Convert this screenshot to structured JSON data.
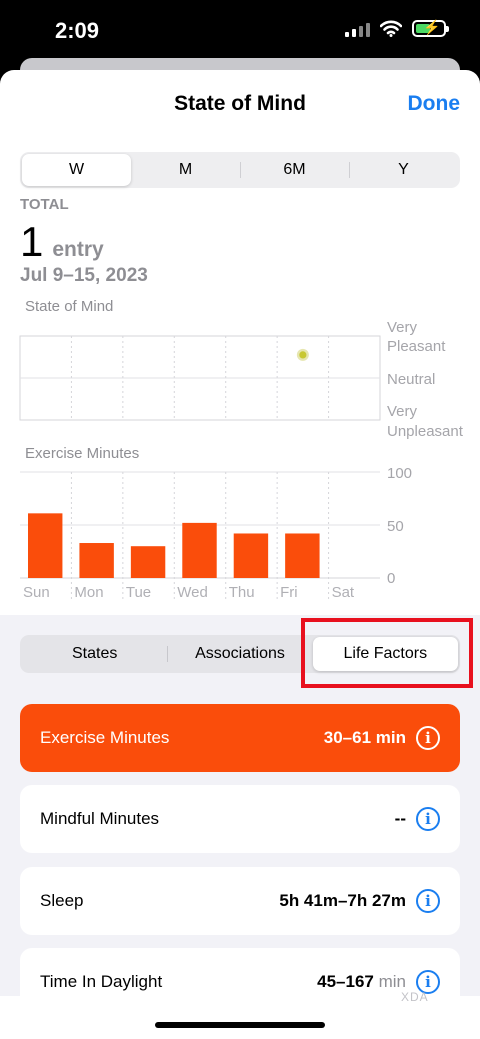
{
  "status": {
    "time": "2:09"
  },
  "nav": {
    "title": "State of Mind",
    "done": "Done"
  },
  "range_tabs": [
    "W",
    "M",
    "6M",
    "Y"
  ],
  "summary": {
    "label": "TOTAL",
    "count": "1",
    "unit": "entry",
    "date_range": "Jul 9–15, 2023"
  },
  "mood_chart": {
    "label": "State of Mind",
    "y_ticks": [
      [
        "Very",
        "Pleasant"
      ],
      [
        "Neutral"
      ],
      [
        "Very",
        "Unpleasant"
      ]
    ]
  },
  "exercise_chart": {
    "label": "Exercise Minutes",
    "y_ticks": [
      "100",
      "50",
      "0"
    ]
  },
  "chart_data": [
    {
      "type": "scatter",
      "title": "State of Mind",
      "categories": [
        "Sun",
        "Mon",
        "Tue",
        "Wed",
        "Thu",
        "Fri",
        "Sat"
      ],
      "points": [
        {
          "day": "Fri",
          "valence": 0.55
        }
      ],
      "ylim": [
        -1,
        1
      ],
      "y_tick_labels": [
        "Very Pleasant",
        "Neutral",
        "Very Unpleasant"
      ],
      "color": "#c8c832"
    },
    {
      "type": "bar",
      "title": "Exercise Minutes",
      "categories": [
        "Sun",
        "Mon",
        "Tue",
        "Wed",
        "Thu",
        "Fri",
        "Sat"
      ],
      "values": [
        61,
        33,
        30,
        52,
        42,
        42,
        0
      ],
      "ylim": [
        0,
        100
      ],
      "color": "#fa4d0b"
    }
  ],
  "view_tabs": [
    "States",
    "Associations",
    "Life Factors"
  ],
  "selected_view_tab": "Life Factors",
  "factors": [
    {
      "label": "Exercise Minutes",
      "value": "30–61",
      "unit": "min",
      "active": true
    },
    {
      "label": "Mindful Minutes",
      "value": "--",
      "unit": "",
      "active": false
    },
    {
      "label": "Sleep",
      "value": "5h 41m–7h 27m",
      "unit": "",
      "active": false
    },
    {
      "label": "Time In Daylight",
      "value": "45–167",
      "unit": "min",
      "active": false
    }
  ],
  "watermark": "XDA",
  "colors": {
    "accent": "#1a7ef0",
    "exercise": "#fa4d0b",
    "highlight": "#e8101e"
  }
}
